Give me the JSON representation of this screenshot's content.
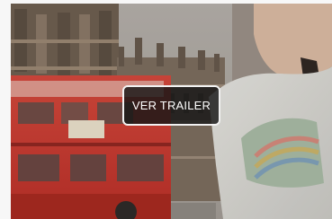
{
  "trailer_card": {
    "button_label": "VER TRAILER"
  }
}
